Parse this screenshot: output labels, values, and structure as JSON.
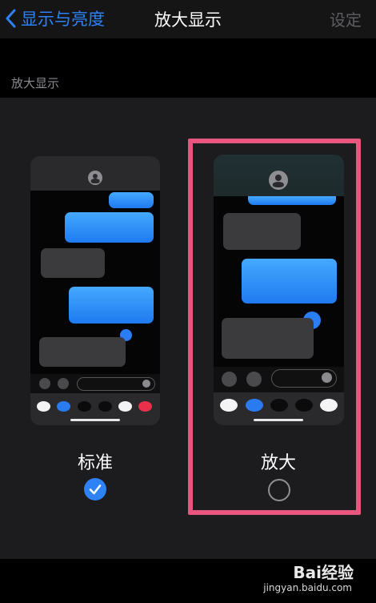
{
  "navbar": {
    "back_label": "显示与亮度",
    "title": "放大显示",
    "action_label": "设定"
  },
  "section": {
    "label": "放大显示"
  },
  "options": [
    {
      "label": "标准",
      "selected": true
    },
    {
      "label": "放大",
      "selected": false
    }
  ],
  "watermark": {
    "logo": "Bai经验",
    "url": "jingyan.baidu.com"
  },
  "colors": {
    "accent": "#2F82F6",
    "highlight": "#E8567F",
    "bubble_blue": "#3A9BFF",
    "bubble_gray": "#3B3B3D"
  }
}
